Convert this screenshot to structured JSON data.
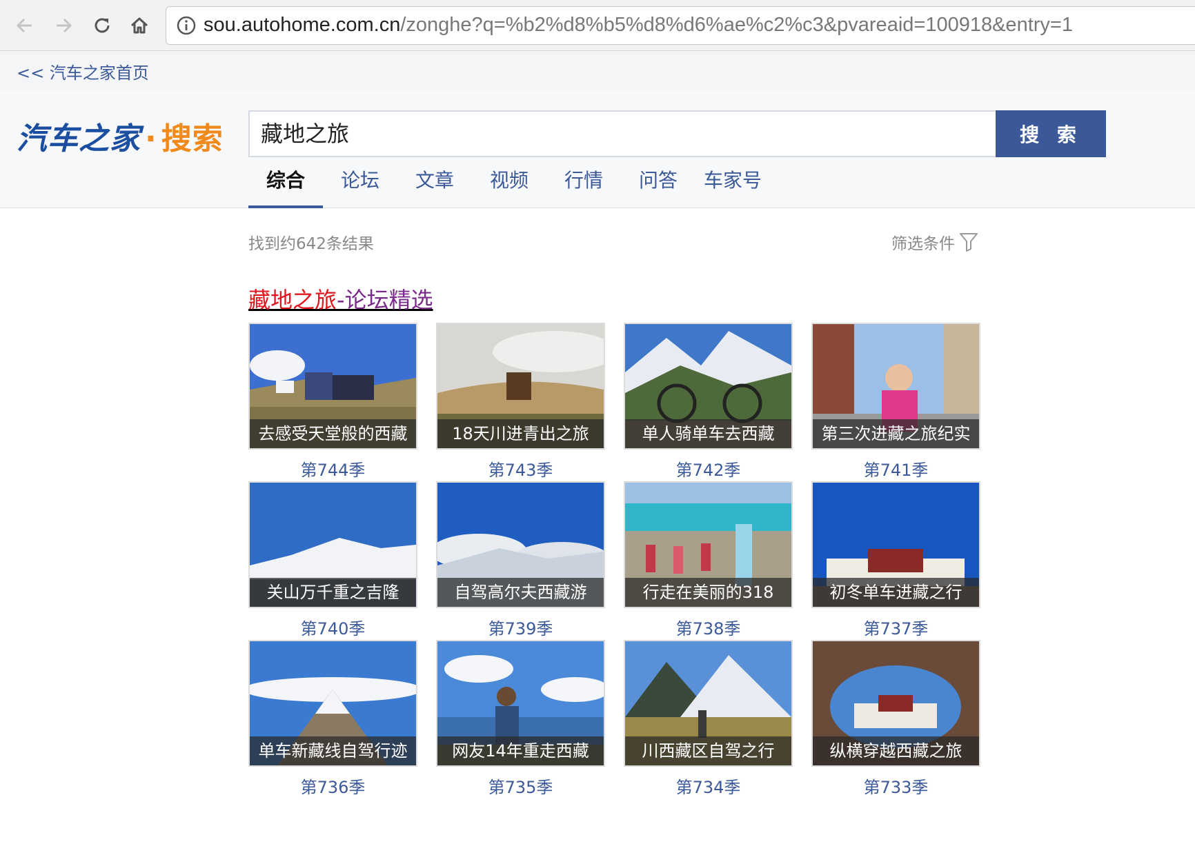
{
  "browser": {
    "url_host": "sou.autohome.com.cn",
    "url_rest": "/zonghe?q=%b2%d8%b5%d8%d6%ae%c2%c3&pvareaid=100918&entry=1",
    "back_icon": "back-arrow-icon",
    "forward_icon": "forward-arrow-icon",
    "reload_icon": "reload-icon",
    "home_icon": "home-icon",
    "info_icon": "info-icon"
  },
  "top_link": "<< 汽车之家首页",
  "logo": {
    "brand": "汽车之家",
    "dot": "·",
    "search": "搜索"
  },
  "search": {
    "query": "藏地之旅",
    "button_label": "搜 索"
  },
  "tabs": [
    {
      "label": "综合",
      "active": true
    },
    {
      "label": "论坛"
    },
    {
      "label": "文章"
    },
    {
      "label": "视频"
    },
    {
      "label": "行情"
    },
    {
      "label": "问答"
    },
    {
      "label": "车家号"
    }
  ],
  "results": {
    "count_text": "找到约642条结果",
    "filter_label": "筛选条件",
    "filter_icon": "funnel-icon"
  },
  "section": {
    "keyword": "藏地之旅",
    "suffix": "-论坛精选"
  },
  "cards": [
    {
      "caption": "去感受天堂般的西藏",
      "season": "第744季"
    },
    {
      "caption": "18天川进青出之旅",
      "season": "第743季"
    },
    {
      "caption": "单人骑单车去西藏",
      "season": "第742季"
    },
    {
      "caption": "第三次进藏之旅纪实",
      "season": "第741季"
    },
    {
      "caption": "关山万千重之吉隆",
      "season": "第740季"
    },
    {
      "caption": "自驾高尔夫西藏游",
      "season": "第739季"
    },
    {
      "caption": "行走在美丽的318",
      "season": "第738季"
    },
    {
      "caption": "初冬单车进藏之行",
      "season": "第737季"
    },
    {
      "caption": "单车新藏线自驾行迹",
      "season": "第736季"
    },
    {
      "caption": "网友14年重走西藏",
      "season": "第735季"
    },
    {
      "caption": "川西藏区自驾之行",
      "season": "第734季"
    },
    {
      "caption": "纵横穿越西藏之旅",
      "season": "第733季"
    }
  ]
}
